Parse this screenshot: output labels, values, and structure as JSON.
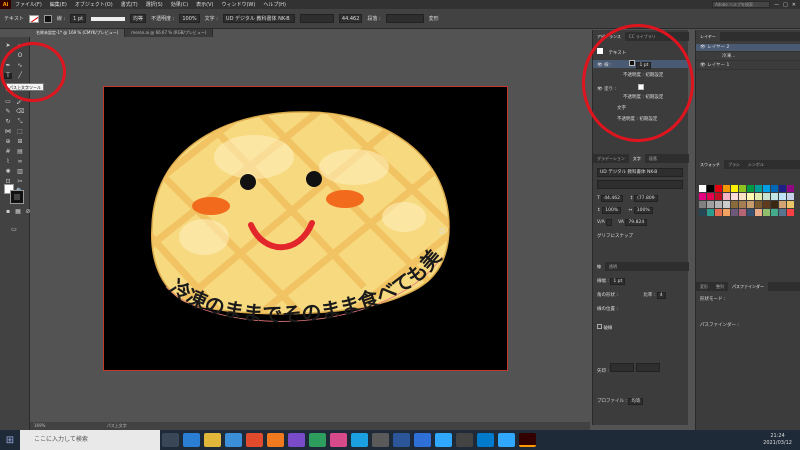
{
  "menubar": {
    "logo": "Ai",
    "items": [
      "ファイル(F)",
      "編集(E)",
      "オブジェクト(O)",
      "書式(T)",
      "選択(S)",
      "効果(C)",
      "表示(V)",
      "ウィンドウ(W)",
      "ヘルプ(H)"
    ],
    "search_placeholder": "Adobe ヘルプを検索"
  },
  "controlbar": {
    "object_type": "テキスト",
    "stroke_label": "線 :",
    "stroke_weight": "1 pt",
    "stroke_style": "均等",
    "opacity_label": "不透明度 :",
    "opacity_value": "100%",
    "char_label": "文字 :",
    "font_name": "UD デジタル 教科書体 NK-B",
    "font_size": "44.462",
    "paragraph_label": "段落 :",
    "transform_label": "変形"
  },
  "doc_tabs": [
    "名称未設定-1* @ 169 % (CMYK/プレビュー)",
    "meron.ai @ 66.67 % (RGB/プレビュー)"
  ],
  "tooltip": "パス上文字ツール",
  "artwork": {
    "curved_text": "冷凍のままでそのまま食べても美味しいよ♪"
  },
  "appearance_panel": {
    "tabs": [
      "アピアランス",
      "CC ライブラリ"
    ],
    "title": "テキスト",
    "stroke_label": "線 :",
    "stroke_value": "1 pt",
    "opacity_label": "不透明度 :",
    "opacity_value": "初期設定",
    "fill_label": "塗り :",
    "char_label": "文字",
    "opacity2_label": "不透明度 :",
    "opacity2_value": "初期設定"
  },
  "character_panel": {
    "tabs": [
      "グラデーション",
      "文字",
      "段落"
    ],
    "font": "UD デジタル 教科書体 NK-B",
    "size": "44.462",
    "leading": "(77.809",
    "hscale": "100%",
    "vscale": "100%",
    "tracking": "79.824",
    "snap": "グリフにスナップ"
  },
  "stroke_panel": {
    "tabs": [
      "線",
      "透明"
    ],
    "weight_label": "線幅 :",
    "weight_value": "1 pt",
    "corner_label": "角の形状 :",
    "limit_label": "比率 :",
    "limit_value": "4",
    "align_label": "線の位置 :",
    "dash_label": "破線",
    "arrow_label": "矢印 :",
    "profile_label": "プロファイル :",
    "profile_value": "均等"
  },
  "layers_panel": {
    "tabs": [
      "レイヤー"
    ],
    "rows": [
      "レイヤー 2",
      "冷凍…",
      "レイヤー 1"
    ]
  },
  "swatches_panel": {
    "tabs": [
      "スウォッチ",
      "ブラシ",
      "シンボル"
    ]
  },
  "pathfinder_panel": {
    "tabs": [
      "変形",
      "整列",
      "パスファインダー"
    ],
    "shape_mode_label": "形状モード :",
    "pathfinder_label": "パスファインダー :"
  },
  "statusbar": {
    "zoom": "169%",
    "tool": "パス上文字"
  },
  "taskbar": {
    "search_placeholder": "ここに入力して検索",
    "time": "21:24",
    "date": "2021/03/12"
  },
  "colors": {
    "bread": "#f7d97f",
    "crust": "#e9b24a",
    "cheek": "#f26b1d",
    "smile": "#e3262b",
    "highlight": "#e0141e"
  }
}
